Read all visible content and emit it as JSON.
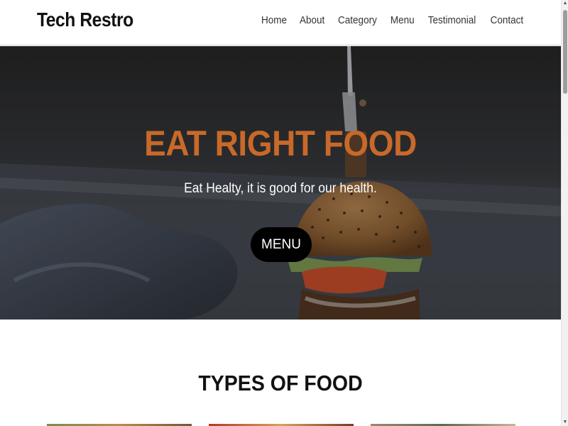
{
  "navbar": {
    "brand": "Tech Restro",
    "links": [
      "Home",
      "About",
      "Category",
      "Menu",
      "Testimonial",
      "Contact"
    ]
  },
  "hero": {
    "title": "EAT RIGHT FOOD",
    "subtitle": "Eat Healty, it is good for our health.",
    "button_label": "MENU",
    "image": "burger-photo"
  },
  "section": {
    "title": "TYPES OF FOOD"
  },
  "colors": {
    "accent": "#c8692a",
    "button_bg": "#000000",
    "text_dark": "#111111"
  },
  "icons": {
    "scroll_up": "scroll-up-arrow-icon",
    "scroll_down": "scroll-down-arrow-icon"
  }
}
